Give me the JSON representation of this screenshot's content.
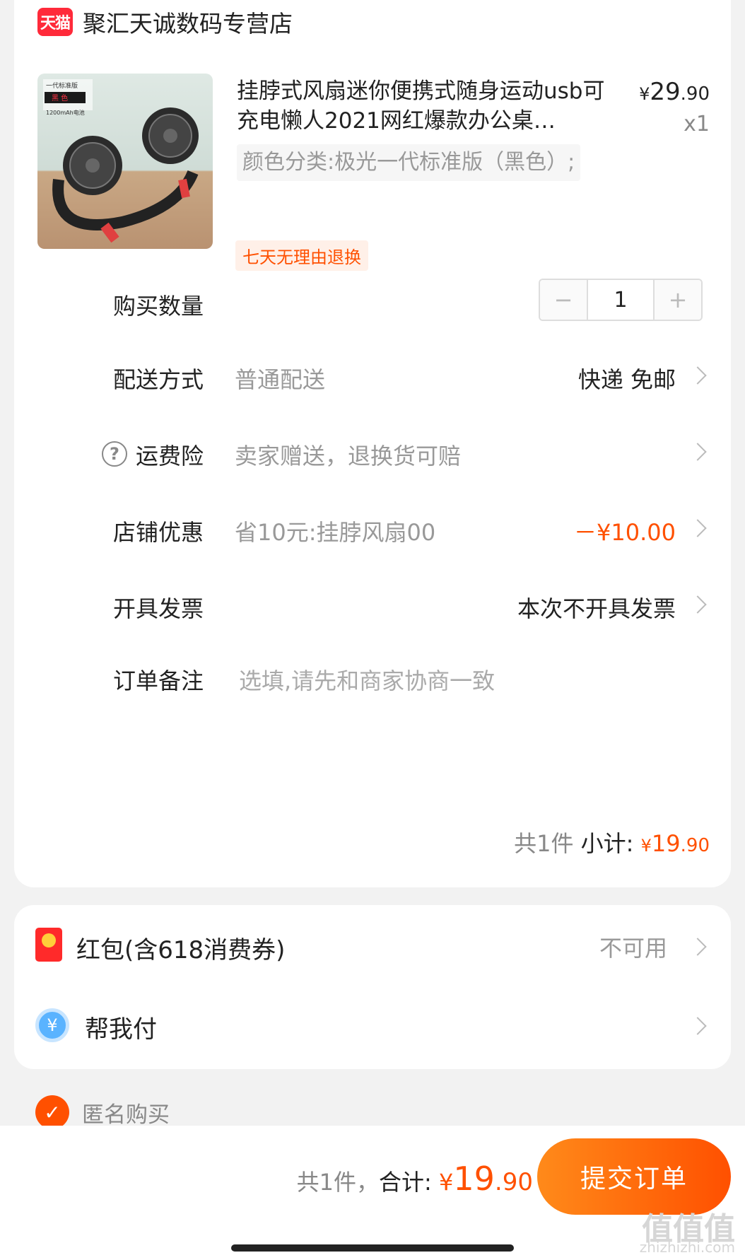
{
  "store": {
    "logo_text": "天猫",
    "name": "聚汇天诚数码专营店"
  },
  "product": {
    "image_text_1": "一代标准版",
    "image_text_2": "黑 色",
    "image_text_3": "1200mAh电池",
    "title": "挂脖式风扇迷你便携式随身运动usb可充电懒人2021网红爆款办公桌…",
    "price_yen": "¥",
    "price_int": "29",
    "price_dec": ".90",
    "quantity": "x1",
    "sku": "颜色分类:极光一代标准版（黑色）;",
    "return_badge": "七天无理由退换"
  },
  "rows": {
    "quantity_label": "购买数量",
    "stepper_minus": "−",
    "stepper_value": "1",
    "stepper_plus": "+",
    "delivery_label": "配送方式",
    "delivery_sub": "普通配送",
    "delivery_value": "快递 免邮",
    "insurance_icon": "?",
    "insurance_label": "运费险",
    "insurance_sub": "卖家赠送，退换货可赔",
    "discount_label": "店铺优惠",
    "discount_sub": "省10元:挂脖风扇00",
    "discount_value": "－¥10.00",
    "invoice_label": "开具发票",
    "invoice_value": "本次不开具发票",
    "note_label": "订单备注",
    "note_placeholder": "选填,请先和商家协商一致"
  },
  "subtotal": {
    "count": "共1件",
    "label": "小计:",
    "yen": "¥",
    "int": "19",
    "dec": ".90"
  },
  "extras": {
    "redpack_label": "红包(含618消费券)",
    "redpack_value": "不可用",
    "helppay_icon": "¥",
    "helppay_label": "帮我付"
  },
  "anonymous": {
    "check": "✓",
    "label": "匿名购买"
  },
  "footer": {
    "count": "共1件，",
    "total_label": "合计:",
    "yen": "¥",
    "int": "19",
    "dec": ".90",
    "submit": "提交订单",
    "watermark": "值值值",
    "watermark_sub": "zhizhizhi.com"
  },
  "colors": {
    "accent": "#ff5000",
    "tmall_red": "#ff2a3a",
    "muted": "#999999"
  },
  "icons": {
    "tmall": "tmall-logo-icon",
    "help": "question-circle-icon",
    "chevron": "chevron-right-icon",
    "redpack": "red-packet-icon",
    "helppay": "yuan-circle-icon",
    "check": "check-circle-icon"
  }
}
